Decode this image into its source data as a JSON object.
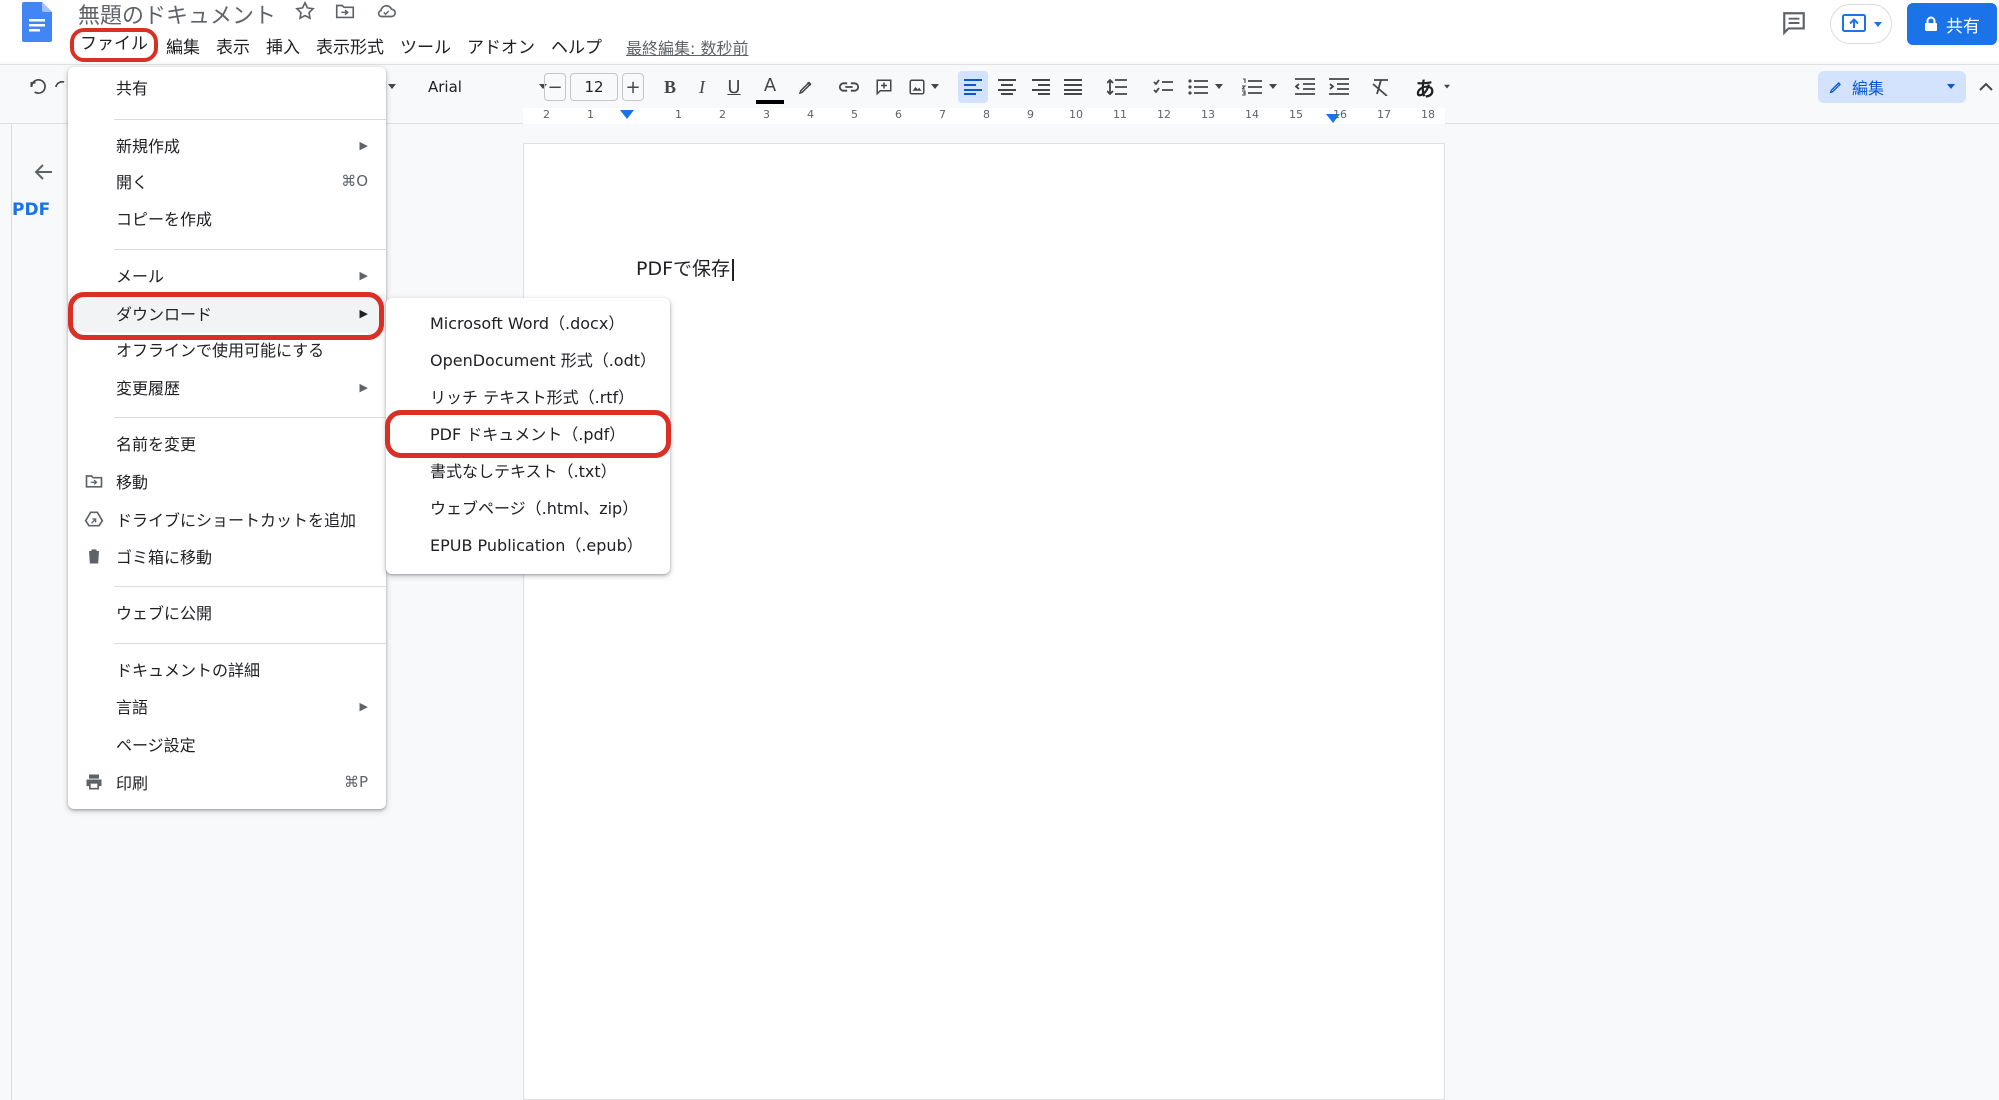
{
  "document": {
    "title": "無題のドキュメント",
    "body_text": "PDFで保存",
    "outline_item": "PDF"
  },
  "menubar": {
    "items": [
      "ファイル",
      "編集",
      "表示",
      "挿入",
      "表示形式",
      "ツール",
      "アドオン",
      "ヘルプ"
    ],
    "last_edit": "最終編集: 数秒前"
  },
  "header": {
    "share_label": "共有"
  },
  "toolbar": {
    "font": "Arial",
    "font_size": "12",
    "minus": "−",
    "plus": "+",
    "bold": "B",
    "italic": "I",
    "underline": "U",
    "text_color": "A",
    "input_tool": "あ",
    "mode_label": "編集"
  },
  "ruler": {
    "marks": [
      "2",
      "1",
      "1",
      "2",
      "3",
      "4",
      "5",
      "6",
      "7",
      "8",
      "9",
      "10",
      "11",
      "12",
      "13",
      "14",
      "15",
      "16",
      "17",
      "18"
    ]
  },
  "file_menu": {
    "share": "共有",
    "new": "新規作成",
    "open": "開く",
    "open_shortcut": "⌘O",
    "make_copy": "コピーを作成",
    "email": "メール",
    "download": "ダウンロード",
    "offline": "オフラインで使用可能にする",
    "version_history": "変更履歴",
    "rename": "名前を変更",
    "move": "移動",
    "add_shortcut": "ドライブにショートカットを追加",
    "trash": "ゴミ箱に移動",
    "publish": "ウェブに公開",
    "details": "ドキュメントの詳細",
    "language": "言語",
    "page_setup": "ページ設定",
    "print": "印刷",
    "print_shortcut": "⌘P"
  },
  "download_submenu": {
    "items": [
      "Microsoft Word（.docx）",
      "OpenDocument 形式（.odt）",
      "リッチ テキスト形式（.rtf）",
      "PDF ドキュメント（.pdf）",
      "書式なしテキスト（.txt）",
      "ウェブページ（.html、zip）",
      "EPUB Publication（.epub）"
    ]
  },
  "colors": {
    "accent": "#1a73e8",
    "highlight_ring": "#d93025"
  }
}
